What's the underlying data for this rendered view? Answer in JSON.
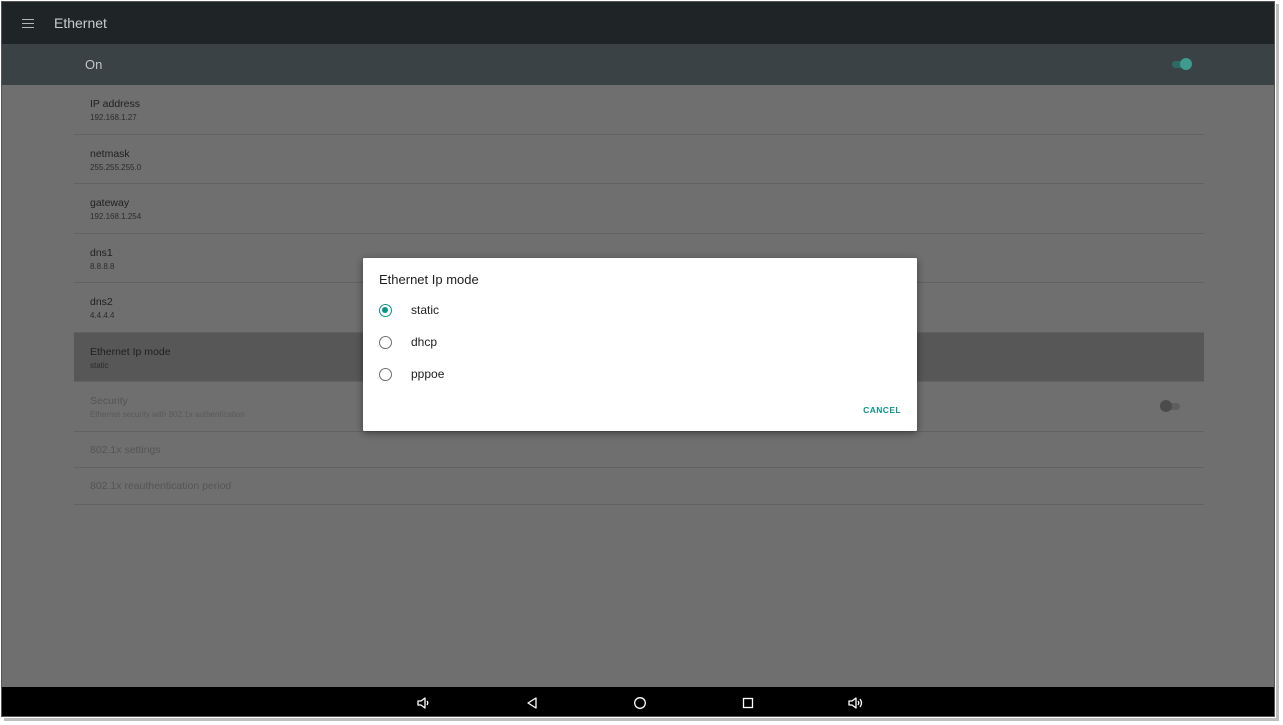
{
  "appbar": {
    "title": "Ethernet",
    "menu_icon": "menu-icon"
  },
  "switchbar": {
    "label": "On",
    "toggle_state": "on"
  },
  "settings": [
    {
      "title": "IP address",
      "value": "192.168.1.27"
    },
    {
      "title": "netmask",
      "value": "255.255.255.0"
    },
    {
      "title": "gateway",
      "value": "192.168.1.254"
    },
    {
      "title": "dns1",
      "value": "8.8.8.8"
    },
    {
      "title": "dns2",
      "value": "4.4.4.4"
    },
    {
      "title": "Ethernet Ip mode",
      "value": "static"
    },
    {
      "title": "Security",
      "value": "Ethernet security with 802.1x authentication",
      "toggle_state": "off"
    },
    {
      "title": "802.1x settings"
    },
    {
      "title": "802.1x reauthentication period"
    }
  ],
  "dialog": {
    "title": "Ethernet Ip mode",
    "options": [
      {
        "label": "static",
        "selected": true
      },
      {
        "label": "dhcp",
        "selected": false
      },
      {
        "label": "pppoe",
        "selected": false
      }
    ],
    "cancel_label": "CANCEL"
  },
  "navbar": {
    "icons": [
      "volume-down-icon",
      "back-icon",
      "home-icon",
      "recents-icon",
      "volume-up-icon"
    ]
  },
  "colors": {
    "accent": "#0d9488",
    "appbar": "#1f2427",
    "switchbar": "#3a4246",
    "scrim_bg": "#6f6f6f"
  }
}
